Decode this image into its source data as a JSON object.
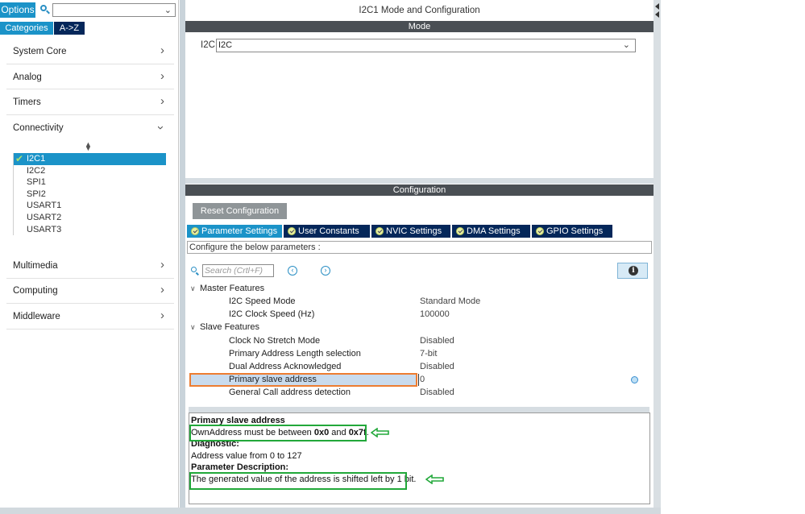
{
  "left_panel": {
    "options_label": "Options",
    "search_placeholder": "",
    "tabs": {
      "categories": "Categories",
      "az": "A->Z"
    },
    "categories": [
      {
        "label": "System Core",
        "expanded": false
      },
      {
        "label": "Analog",
        "expanded": false
      },
      {
        "label": "Timers",
        "expanded": false
      },
      {
        "label": "Connectivity",
        "expanded": true
      },
      {
        "label": "Multimedia",
        "expanded": false
      },
      {
        "label": "Computing",
        "expanded": false
      },
      {
        "label": "Middleware",
        "expanded": false
      }
    ],
    "connectivity_items": [
      "I2C1",
      "I2C2",
      "SPI1",
      "SPI2",
      "USART1",
      "USART2",
      "USART3"
    ],
    "selected_item": "I2C1"
  },
  "right_panel": {
    "title": "I2C1 Mode and Configuration",
    "mode_header": "Mode",
    "mode_field_label": "I2C",
    "mode_field_value": "I2C",
    "config_header": "Configuration",
    "reset_button": "Reset Configuration",
    "tabs": [
      "Parameter Settings",
      "User Constants",
      "NVIC Settings",
      "DMA Settings",
      "GPIO Settings"
    ],
    "active_tab": "Parameter Settings",
    "configure_text": "Configure the below parameters :",
    "search_placeholder": "Search (Crtl+F)",
    "groups": [
      {
        "name": "Master Features",
        "params": [
          {
            "name": "I2C Speed Mode",
            "value": "Standard Mode"
          },
          {
            "name": "I2C Clock Speed (Hz)",
            "value": "100000"
          }
        ]
      },
      {
        "name": "Slave Features",
        "params": [
          {
            "name": "Clock No Stretch Mode",
            "value": "Disabled"
          },
          {
            "name": "Primary Address Length selection",
            "value": "7-bit"
          },
          {
            "name": "Dual Address Acknowledged",
            "value": "Disabled"
          },
          {
            "name": "Primary slave address",
            "value": "0"
          },
          {
            "name": "General Call address detection",
            "value": "Disabled"
          }
        ]
      }
    ],
    "selected_param": "Primary slave address",
    "description": {
      "title": "Primary slave address",
      "own_address_pre": "OwnAddress must be between ",
      "own_address_min": "0x0",
      "own_address_mid": " and ",
      "own_address_max": "0x7f",
      "own_address_post": ".",
      "diagnostic_label": "Diagnostic:",
      "diagnostic_text": "Address value from 0 to 127",
      "param_desc_label": "Parameter Description:",
      "param_desc_text": "The generated value of the address is shifted left by 1 bit."
    }
  },
  "colors": {
    "accent_blue": "#1b93c8",
    "dark_navy": "#04275a",
    "header_gray": "#4a4f54",
    "highlight_orange": "#ed7d31",
    "annotation_green": "#22a83a"
  }
}
